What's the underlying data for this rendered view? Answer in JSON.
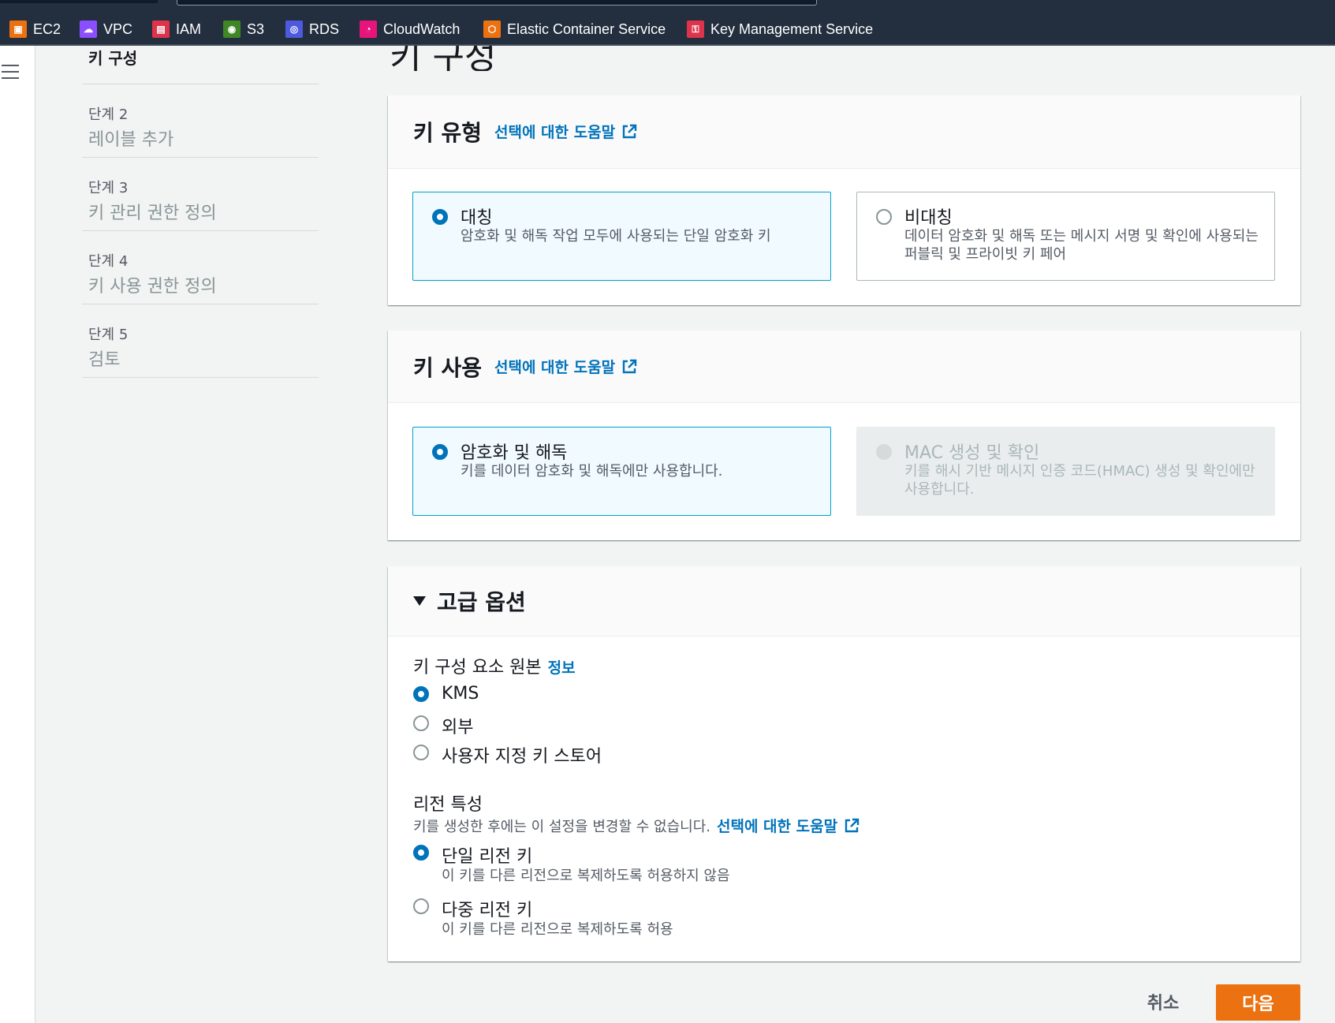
{
  "favorites": [
    {
      "label": "EC2",
      "icon": "ec2-icon",
      "color": "#ec7211"
    },
    {
      "label": "VPC",
      "icon": "vpc-icon",
      "color": "#8c4fff"
    },
    {
      "label": "IAM",
      "icon": "iam-icon",
      "color": "#dd344c"
    },
    {
      "label": "S3",
      "icon": "s3-icon",
      "color": "#3f8624"
    },
    {
      "label": "RDS",
      "icon": "rds-icon",
      "color": "#4d5ae0"
    },
    {
      "label": "CloudWatch",
      "icon": "cloudwatch-icon",
      "color": "#e7157b"
    },
    {
      "label": "Elastic Container Service",
      "icon": "ecs-icon",
      "color": "#ec7211"
    },
    {
      "label": "Key Management Service",
      "icon": "kms-icon",
      "color": "#dd344c"
    }
  ],
  "page_title": "키 구성",
  "steps": {
    "current_label": "키 구성",
    "items": [
      {
        "num": "단계 2",
        "label": "레이블 추가"
      },
      {
        "num": "단계 3",
        "label": "키 관리 권한 정의"
      },
      {
        "num": "단계 4",
        "label": "키 사용 권한 정의"
      },
      {
        "num": "단계 5",
        "label": "검토"
      }
    ]
  },
  "key_type": {
    "heading": "키 유형",
    "help": "선택에 대한 도움말",
    "options": [
      {
        "title": "대칭",
        "desc": "암호화 및 해독 작업 모두에 사용되는 단일 암호화 키",
        "selected": true
      },
      {
        "title": "비대칭",
        "desc": "데이터 암호화 및 해독 또는 메시지 서명 및 확인에 사용되는 퍼블릭 및 프라이빗 키 페어",
        "selected": false
      }
    ]
  },
  "key_usage": {
    "heading": "키 사용",
    "help": "선택에 대한 도움말",
    "options": [
      {
        "title": "암호화 및 해독",
        "desc": "키를 데이터 암호화 및 해독에만 사용합니다.",
        "selected": true
      },
      {
        "title": "MAC 생성 및 확인",
        "desc": "키를 해시 기반 메시지 인증 코드(HMAC) 생성 및 확인에만 사용합니다.",
        "selected": false,
        "disabled": true
      }
    ]
  },
  "advanced": {
    "heading": "고급 옵션",
    "origin": {
      "label": "키 구성 요소 원본",
      "info": "정보",
      "options": [
        {
          "label": "KMS",
          "selected": true
        },
        {
          "label": "외부",
          "selected": false
        },
        {
          "label": "사용자 지정 키 스토어",
          "selected": false
        }
      ]
    },
    "regionality": {
      "label": "리전 특성",
      "desc": "키를 생성한 후에는 이 설정을 변경할 수 없습니다.",
      "help": "선택에 대한 도움말",
      "options": [
        {
          "label": "단일 리전 키",
          "sub": "이 키를 다른 리전으로 복제하도록 허용하지 않음",
          "selected": true
        },
        {
          "label": "다중 리전 키",
          "sub": "이 키를 다른 리전으로 복제하도록 허용",
          "selected": false
        }
      ]
    }
  },
  "footer": {
    "cancel": "취소",
    "next": "다음"
  }
}
